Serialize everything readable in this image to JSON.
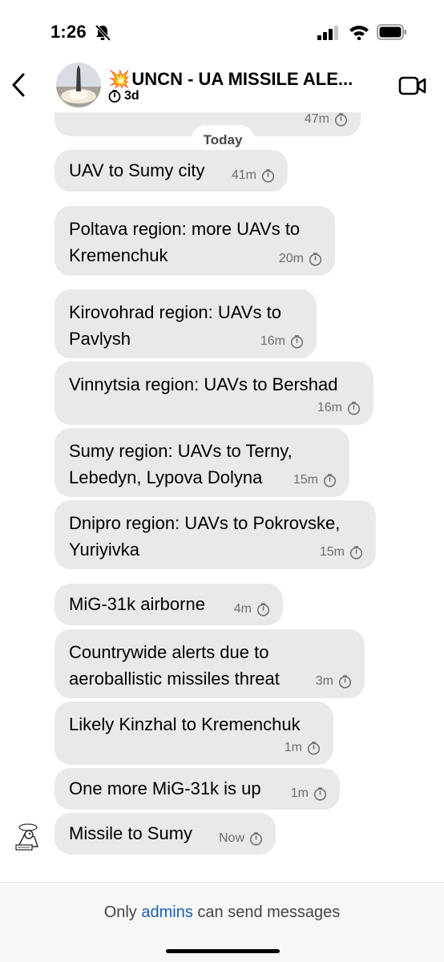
{
  "status": {
    "time": "1:26"
  },
  "header": {
    "title": "UNCN - UA MISSILE ALE...",
    "title_emoji": "💥",
    "timer": "3d"
  },
  "chat": {
    "date_separator": "Today",
    "messages": [
      {
        "text": "",
        "time": "47m"
      },
      {
        "text": "UAV to Sumy city",
        "time": "41m"
      },
      {
        "text": "Poltava region: more UAVs to Kremenchuk",
        "time": "20m"
      },
      {
        "text": "Kirovohrad region: UAVs to Pavlysh",
        "time": "16m"
      },
      {
        "text": "Vinnytsia region: UAVs to Bershad",
        "time": "16m"
      },
      {
        "text": "Sumy region: UAVs to Terny, Lebedyn, Lypova Dolyna",
        "time": "15m"
      },
      {
        "text": "Dnipro region: UAVs to Pokrovske, Yuriyivka",
        "time": "15m"
      },
      {
        "text": "MiG-31k airborne",
        "time": "4m"
      },
      {
        "text": "Countrywide alerts due to aeroballistic missiles threat",
        "time": "3m"
      },
      {
        "text": "Likely Kinzhal to Kremenchuk",
        "time": "1m"
      },
      {
        "text": "One more MiG-31k is up",
        "time": "1m"
      },
      {
        "text": "Missile to Sumy",
        "time": "Now"
      }
    ]
  },
  "footer": {
    "prefix": "Only ",
    "link": "admins",
    "suffix": " can send messages"
  }
}
